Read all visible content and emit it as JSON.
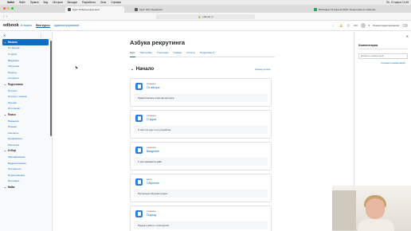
{
  "os_menubar": {
    "items": [
      "Safari",
      "Файл",
      "Правка",
      "Вид",
      "История",
      "Вкладки",
      "Разработка",
      "Окно",
      "Справка"
    ],
    "clock": "Пн, 21 марта 13:45"
  },
  "browser": {
    "tabs": [
      {
        "title": "Курс: Азбука рекрутинга"
      },
      {
        "title": "Курс: HR-специалист"
      },
      {
        "title": "Вебинары 15 апреля 2022г. Подготовка по записям"
      }
    ],
    "url": "edbook.ru"
  },
  "header": {
    "logo": "edbook",
    "nav": [
      "В начало",
      "Мои курсы",
      "Администрирование"
    ],
    "language": "RU",
    "edit_mode": "Режим редактирования"
  },
  "course_index": {
    "sections": [
      {
        "label": "Начало",
        "active": true,
        "items": [
          "От автора",
          "О курсе",
          "Введение",
          "Обучение",
          "Подход",
          "Алгоритм"
        ]
      },
      {
        "label": "Подготовка",
        "items": [
          "Портрет",
          "Портрет: оценка",
          "Оценка",
          "Источники"
        ]
      },
      {
        "label": "Поиск",
        "items": [
          "Вакансия",
          "Резюме",
          "Контакты",
          "Профайлинг",
          "Рассылка"
        ]
      },
      {
        "label": "Отбор",
        "items": [
          "Квалификация",
          "Видеоинтервью",
          "Портфолио",
          "Перепроверка",
          "Интервью"
        ]
      },
      {
        "label": "Найм",
        "items": []
      }
    ]
  },
  "course": {
    "title": "Азбука рекрутинга",
    "tabs": [
      "Курс",
      "Настройки",
      "Участники",
      "Оценки",
      "Отчеты",
      "Подробнее ▾"
    ],
    "active_tab": "Курс",
    "section_title": "Начало",
    "collapse_all": "Свернуть всё",
    "activities": [
      {
        "kind": "страница",
        "name": "От автора",
        "description": "Приветственное слово автора курса."
      },
      {
        "kind": "страница",
        "name": "О курсе",
        "description": "О чём этот курс и его устройство."
      },
      {
        "kind": "страница",
        "name": "Введение",
        "description": "С чего начинается найм."
      },
      {
        "kind": "книга",
        "name": "Обучение",
        "description": "Построение обучения в курсе."
      },
      {
        "kind": "страница",
        "name": "Подход",
        "description": "Подход к работе с этим курсом."
      }
    ]
  },
  "block_drawer": {
    "title": "Комментарии",
    "input_placeholder": "Добавить комментарий...",
    "link": "Сохранить комментарий"
  },
  "colors": {
    "accent": "#0f6cbf",
    "activity_icon": "#2f7ed8",
    "drawer_bg": "#f8f9fa"
  }
}
